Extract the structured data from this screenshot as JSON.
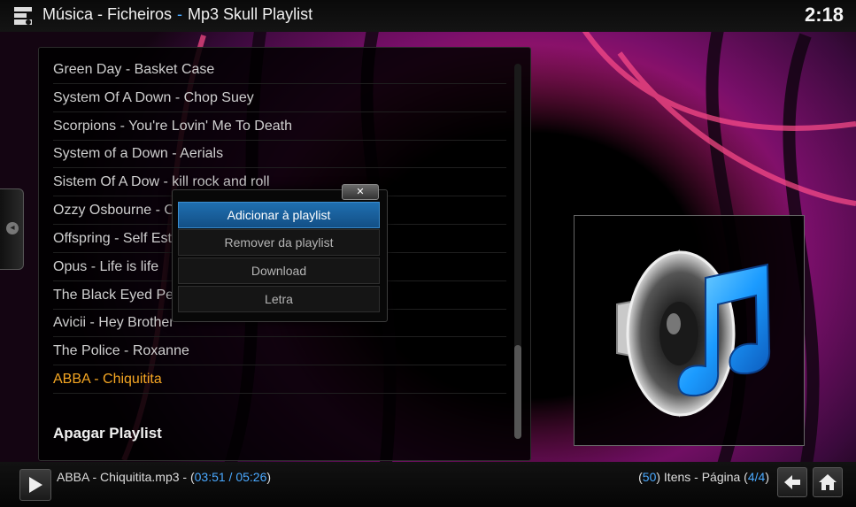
{
  "header": {
    "section": "Música - Ficheiros",
    "subsection": "Mp3 Skull Playlist",
    "clock": "2:18"
  },
  "playlist": {
    "items": [
      {
        "label": "Green Day - Basket Case"
      },
      {
        "label": "System Of A Down - Chop Suey"
      },
      {
        "label": "Scorpions - You're Lovin' Me To Death"
      },
      {
        "label": "System of a Down - Aerials"
      },
      {
        "label": "Sistem Of A Dow - kill rock and roll"
      },
      {
        "label": "Ozzy Osbourne - C"
      },
      {
        "label": "Offspring - Self Est"
      },
      {
        "label": "Opus - Life is life"
      },
      {
        "label": "The Black Eyed Pea"
      },
      {
        "label": "Avicii - Hey Brother"
      },
      {
        "label": "The Police - Roxanne"
      },
      {
        "label": "ABBA - Chiquitita",
        "playing": true
      }
    ],
    "clear_label": "Apagar Playlist"
  },
  "context_menu": {
    "close_label": "✕",
    "items": [
      {
        "label": "Adicionar à playlist",
        "focused": true
      },
      {
        "label": "Remover da playlist"
      },
      {
        "label": "Download"
      },
      {
        "label": "Letra"
      }
    ]
  },
  "thumbnail": {
    "icon": "music-speaker-icon"
  },
  "footer": {
    "filename": "ABBA - Chiquitita.mp3 - (",
    "elapsed": "03:51",
    "time_sep": " / ",
    "duration": "05:26",
    "close_paren": ")",
    "count_open": "(",
    "count": "50",
    "count_mid": ") Itens - Página (",
    "page": "4/4",
    "count_close": ")"
  },
  "colors": {
    "accent": "#4aa9ff",
    "playing": "#f5a623",
    "focus": "#1f6fb0"
  }
}
